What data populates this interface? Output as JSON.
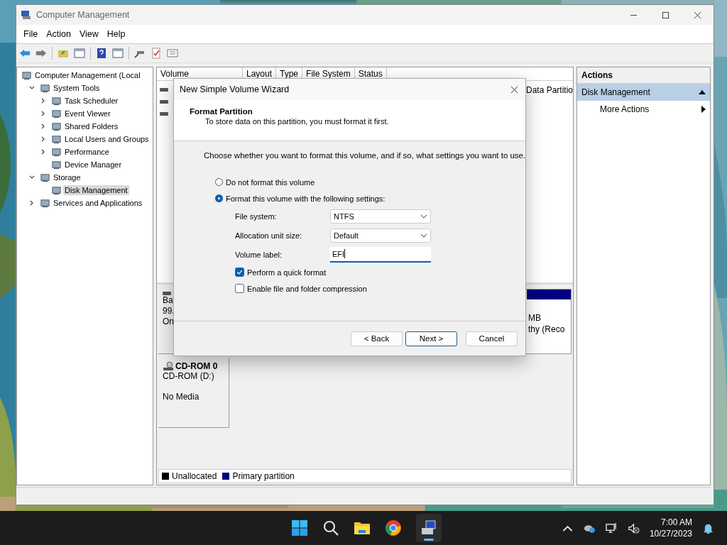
{
  "window": {
    "title": "Computer Management"
  },
  "menu": [
    "File",
    "Action",
    "View",
    "Help"
  ],
  "tree": [
    {
      "label": "Computer Management (Local",
      "selected": false,
      "children": [
        {
          "label": "System Tools",
          "expanded": true,
          "selected": false,
          "children": [
            {
              "label": "Task Scheduler",
              "expanded": false,
              "selected": false
            },
            {
              "label": "Event Viewer",
              "expanded": false,
              "selected": false
            },
            {
              "label": "Shared Folders",
              "expanded": false,
              "selected": false
            },
            {
              "label": "Local Users and Groups",
              "expanded": false,
              "selected": false
            },
            {
              "label": "Performance",
              "expanded": false,
              "selected": false
            },
            {
              "label": "Device Manager",
              "selected": false
            }
          ]
        },
        {
          "label": "Storage",
          "expanded": true,
          "selected": false,
          "children": [
            {
              "label": "Disk Management",
              "selected": true
            }
          ]
        },
        {
          "label": "Services and Applications",
          "expanded": false,
          "selected": false
        }
      ]
    }
  ],
  "volume_table": {
    "columns": [
      "Volume",
      "Layout",
      "Type",
      "File System",
      "Status"
    ],
    "rows": [
      {
        "status": "Data Partitio"
      }
    ]
  },
  "disks": [
    {
      "kind": "basic",
      "label_lines": [
        "Ba",
        "99.",
        "On"
      ],
      "partition_lines": [
        "MB",
        "thy (Reco"
      ]
    },
    {
      "kind": "cdrom",
      "name": "CD-ROM 0",
      "lines": [
        "CD-ROM (D:)",
        "No Media"
      ]
    }
  ],
  "legend": [
    {
      "label": "Unallocated",
      "color": "#000000"
    },
    {
      "label": "Primary partition",
      "color": "#000080"
    }
  ],
  "actions": {
    "title": "Actions",
    "items": [
      {
        "label": "Disk Management",
        "kind": "header"
      },
      {
        "label": "More Actions",
        "kind": "submenu"
      }
    ]
  },
  "dialog": {
    "title": "New Simple Volume Wizard",
    "heading": "Format Partition",
    "subheading": "To store data on this partition, you must format it first.",
    "prompt": "Choose whether you want to format this volume, and if so, what settings you want to use.",
    "options": [
      {
        "label": "Do not format this volume",
        "selected": false
      },
      {
        "label": "Format this volume with the following settings:",
        "selected": true
      }
    ],
    "fields": [
      {
        "label": "File system:",
        "value": "NTFS",
        "kind": "dropdown"
      },
      {
        "label": "Allocation unit size:",
        "value": "Default",
        "kind": "dropdown"
      },
      {
        "label": "Volume label:",
        "value": "EFI",
        "kind": "text"
      }
    ],
    "checkboxes": [
      {
        "label": "Perform a quick format",
        "checked": true
      },
      {
        "label": "Enable file and folder compression",
        "checked": false
      }
    ],
    "buttons": [
      {
        "label": "< Back",
        "default": false
      },
      {
        "label": "Next >",
        "default": true
      },
      {
        "label": "Cancel",
        "default": false
      }
    ]
  },
  "taskbar": {
    "time": "7:00 AM",
    "date": "10/27/2023"
  }
}
